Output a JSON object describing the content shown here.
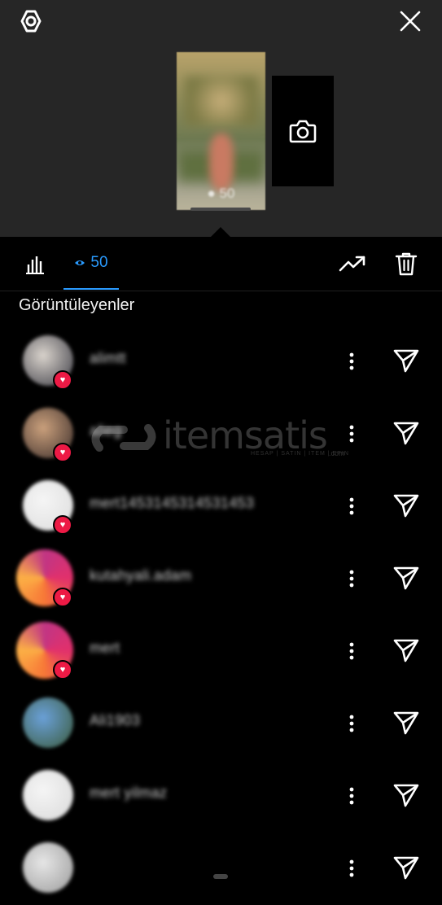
{
  "story": {
    "view_count_label": "50"
  },
  "tabs": {
    "viewers_count": "50"
  },
  "section": {
    "title": "Görüntüleyenler"
  },
  "watermark": {
    "brand": "itemsatis",
    "tagline": "HESAP | SATIN | ITEM | EPIN",
    "suffix": ".com"
  },
  "viewers": [
    {
      "username": "alimtt",
      "liked": true,
      "avatar_colors": [
        "#d9d3cc",
        "#3b3b44"
      ],
      "story_ring": false
    },
    {
      "username": "alieg",
      "liked": true,
      "avatar_colors": [
        "#caa07c",
        "#3b2d2a"
      ],
      "story_ring": false
    },
    {
      "username": "mert1453145314531453",
      "liked": true,
      "avatar_colors": [
        "#f5f5f5",
        "#dcdcdc"
      ],
      "story_ring": false
    },
    {
      "username": "kutahyali.adam",
      "liked": true,
      "avatar_colors": [
        "#6d6d6d",
        "#1a1a1a"
      ],
      "story_ring": true
    },
    {
      "username": "mert",
      "liked": true,
      "avatar_colors": [
        "#8a6a3a",
        "#1a140d"
      ],
      "story_ring": true
    },
    {
      "username": "Ali1903",
      "liked": false,
      "avatar_colors": [
        "#6aa0d8",
        "#3a5a3a"
      ],
      "story_ring": false
    },
    {
      "username": "mert yilmaz",
      "liked": false,
      "avatar_colors": [
        "#f5f5f5",
        "#d9d9d9"
      ],
      "story_ring": false
    },
    {
      "username": "",
      "liked": false,
      "avatar_colors": [
        "#e6e6e6",
        "#9a9a9a"
      ],
      "story_ring": false
    }
  ],
  "colors": {
    "accent": "#2a9bff",
    "heart": "#ed1a45",
    "background": "#000000",
    "top_background": "#262626"
  },
  "icons": [
    "settings-icon",
    "close-icon",
    "camera-icon",
    "bar-chart-icon",
    "eye-icon",
    "trending-up-icon",
    "trash-icon",
    "more-vertical-icon",
    "send-icon",
    "heart-icon"
  ]
}
